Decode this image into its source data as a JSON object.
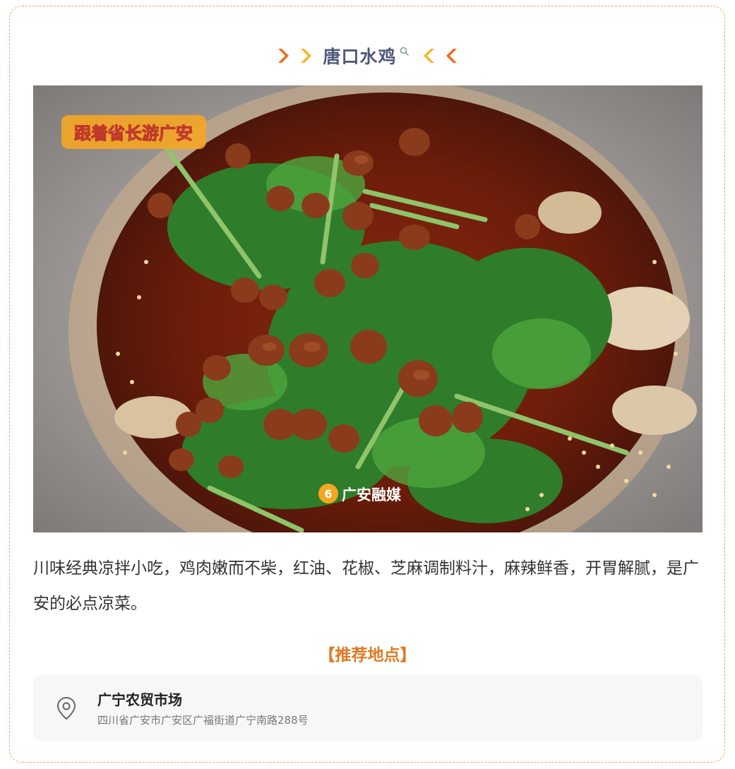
{
  "header": {
    "title": "唐口水鸡",
    "decor_left_icons": [
      "chevron-right-orange",
      "chevron-right-yellow"
    ],
    "decor_right_icons": [
      "chevron-left-yellow",
      "chevron-left-orange"
    ],
    "search_icon": "search-icon"
  },
  "photo": {
    "alt_subject": "dish-photo",
    "watermark_logo_text": "跟着省长游广安",
    "media_watermark": "广安融媒"
  },
  "description": "川味经典凉拌小吃，鸡肉嫩而不柴，红油、花椒、芝麻调制料汁，麻辣鲜香，开胃解腻，是广安的必点凉菜。",
  "recommend": {
    "heading": "【推荐地点】",
    "place_name": "广宁农贸市场",
    "address": "四川省广安市广安区广福街道广宁南路288号",
    "icon": "location-pin-icon"
  },
  "colors": {
    "accent_orange": "#f26a21",
    "accent_yellow": "#f7b52c",
    "title_text": "#4e5a7a",
    "section_heading": "#e07a24",
    "border_dashed": "#f0a070"
  }
}
